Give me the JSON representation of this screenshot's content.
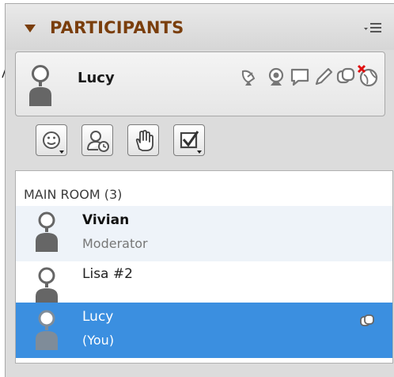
{
  "panel": {
    "title": "PARTICIPANTS"
  },
  "me": {
    "name": "Lucy"
  },
  "room": {
    "label": "MAIN ROOM (3)"
  },
  "participants": [
    {
      "name": "Vivian",
      "role": "Moderator"
    },
    {
      "name": "Lisa #2",
      "role": ""
    },
    {
      "name": "Lucy",
      "role": "(You)"
    }
  ],
  "icons": {
    "collapse": "triangle-down-icon",
    "menu": "panel-menu-icon",
    "status": [
      "satellite-dish-icon",
      "webcam-icon",
      "chat-bubble-icon",
      "pencil-icon",
      "share-icon",
      "close-globe-icon"
    ],
    "buttons": [
      "emoticon-icon",
      "away-clock-icon",
      "raise-hand-icon",
      "poll-check-icon"
    ]
  },
  "colors": {
    "title": "#7a3e0c",
    "selected_row": "#3b8fe0",
    "moderator_row": "#eef3f9"
  }
}
